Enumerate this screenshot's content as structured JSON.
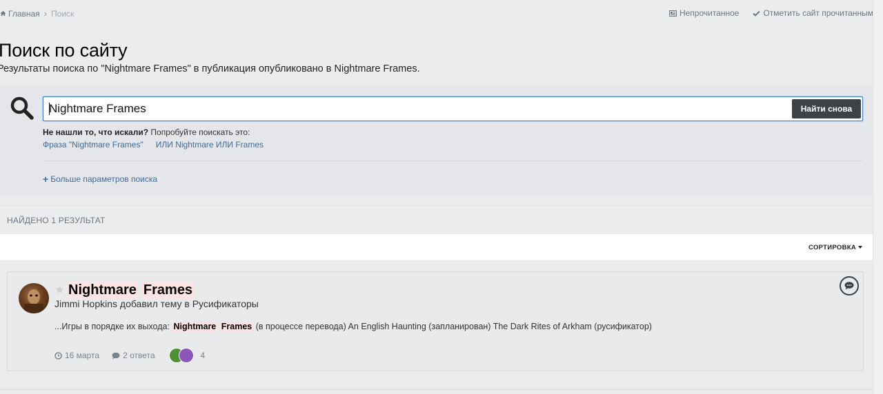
{
  "breadcrumb": {
    "home": "Главная",
    "current": "Поиск"
  },
  "top_actions": {
    "unread": "Непрочитанное",
    "mark_read": "Отметить сайт прочитанным"
  },
  "page": {
    "title": "Поиск по сайту",
    "subtitle": "Результаты поиска по \"Nightmare Frames\" в публикация опубликовано в Nightmare Frames."
  },
  "search": {
    "value": "Nightmare Frames",
    "button": "Найти снова",
    "not_found_bold": "Не нашли то, что искали?",
    "not_found_rest": " Попробуйте поискать это:",
    "suggestions": [
      "Фраза \"Nightmare Frames\"",
      "ИЛИ Nightmare ИЛИ Frames"
    ],
    "more_params": "Больше параметров поиска"
  },
  "results": {
    "count_label": "НАЙДЕНО 1 РЕЗУЛЬТАТ",
    "sort_label": "СОРТИРОВКА",
    "items": [
      {
        "title_words": [
          "Nightmare",
          "Frames"
        ],
        "author": "Jimmi Hopkins",
        "action": " добавил тему в ",
        "forum": "Русификаторы",
        "snippet_before": "...Игры в порядке их выхода: ",
        "snippet_hl": [
          "Nightmare",
          "Frames"
        ],
        "snippet_after": " (в процессе перевода) An English Haunting (запланирован) The Dark Rites of Arkham (русификатор)",
        "date": "16 марта",
        "replies": "2 ответа",
        "reactions": "4"
      }
    ]
  },
  "colors": {
    "accent": "#3e6a9a",
    "highlight": "#fde3e3",
    "button": "#3d4247"
  }
}
